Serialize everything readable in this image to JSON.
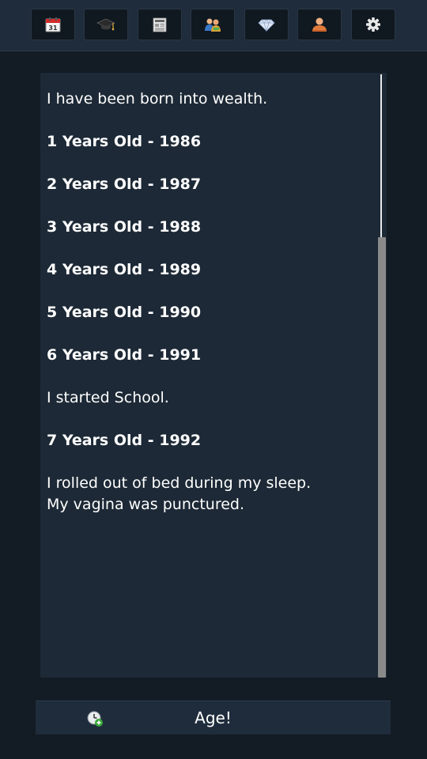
{
  "toolbar": {
    "tabs": [
      {
        "icon": "calendar-icon",
        "label": "31"
      },
      {
        "icon": "graduation-cap-icon"
      },
      {
        "icon": "newspaper-icon"
      },
      {
        "icon": "relationships-icon"
      },
      {
        "icon": "diamond-icon"
      },
      {
        "icon": "person-icon"
      },
      {
        "icon": "gear-icon"
      }
    ]
  },
  "log": {
    "entries": [
      {
        "type": "event",
        "text": "I have been born into wealth."
      },
      {
        "type": "year",
        "text": "1 Years Old  - 1986"
      },
      {
        "type": "year",
        "text": "2 Years Old  - 1987"
      },
      {
        "type": "year",
        "text": "3 Years Old  - 1988"
      },
      {
        "type": "year",
        "text": "4 Years Old  - 1989"
      },
      {
        "type": "year",
        "text": "5 Years Old  - 1990"
      },
      {
        "type": "year",
        "text": "6 Years Old  - 1991"
      },
      {
        "type": "event",
        "text": "I started School."
      },
      {
        "type": "year",
        "text": "7 Years Old  - 1992"
      },
      {
        "type": "event",
        "text": "I rolled out of bed during my sleep.\nMy vagina was punctured."
      }
    ]
  },
  "age_button": {
    "label": "Age!",
    "icon": "clock-plus-icon"
  },
  "colors": {
    "background": "#131b24",
    "topbar": "#1f2c3b",
    "panel": "#1d2936",
    "text": "#ffffff",
    "scroll_thumb": "#8a8a8a"
  }
}
